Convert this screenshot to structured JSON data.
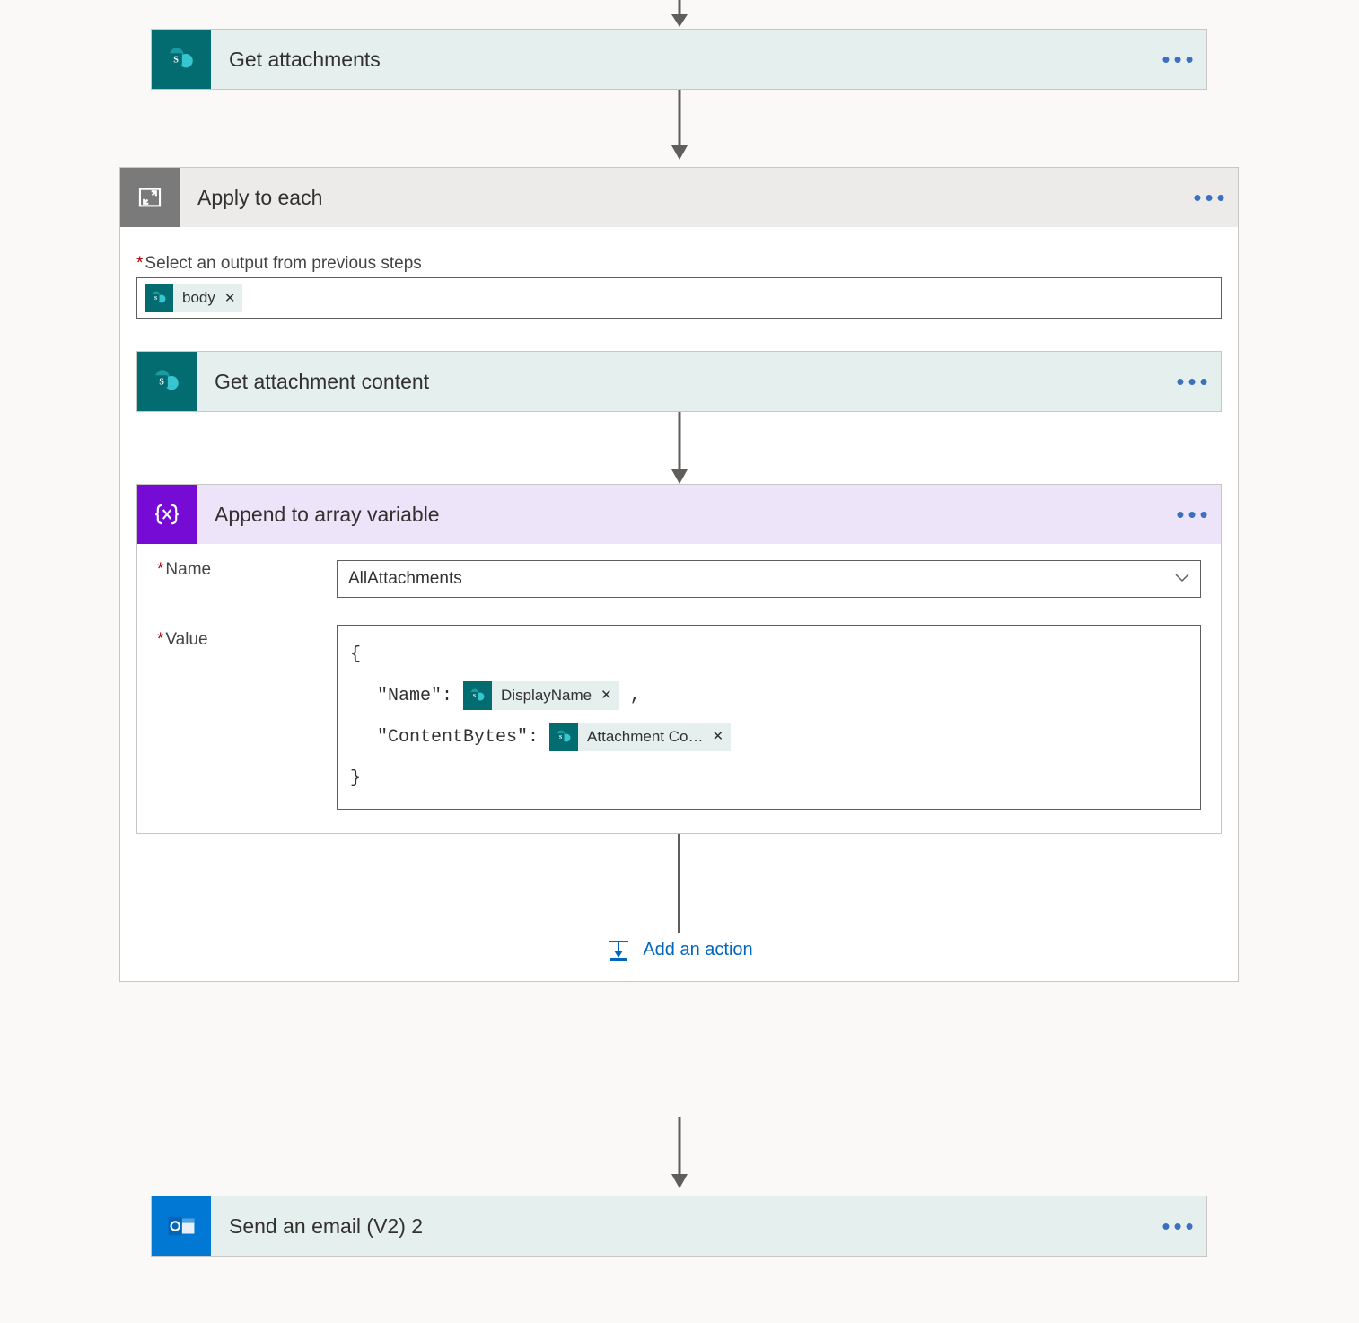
{
  "step_get_attachments": {
    "title": "Get attachments"
  },
  "apply_each": {
    "title": "Apply to each",
    "select_label": "Select an output from previous steps",
    "token_body": "body"
  },
  "step_get_attachment_content": {
    "title": "Get attachment content"
  },
  "step_append": {
    "title": "Append to array variable",
    "name_label": "Name",
    "name_value": "AllAttachments",
    "value_label": "Value",
    "obj_open": "{",
    "obj_close": "}",
    "name_key": "\"Name\":",
    "contentbytes_key": "\"ContentBytes\":",
    "comma": ",",
    "token_displayname": "DisplayName",
    "token_attachcontent": "Attachment Co…"
  },
  "add_action": "Add an action",
  "step_send_email": {
    "title": "Send an email (V2) 2"
  }
}
